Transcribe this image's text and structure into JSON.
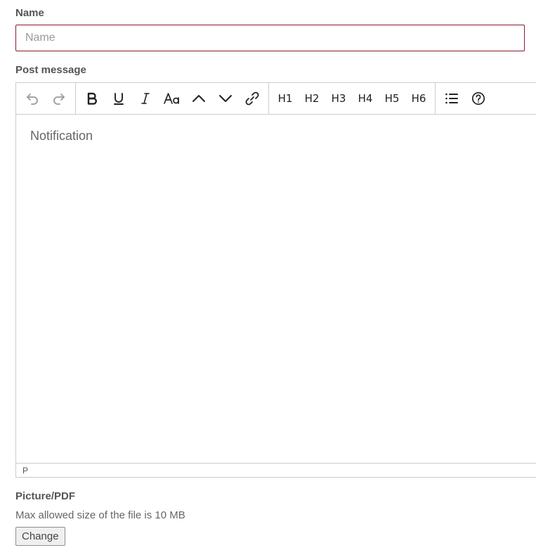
{
  "form": {
    "name_label": "Name",
    "name_placeholder": "Name",
    "name_value": "",
    "post_label": "Post message",
    "picture_label": "Picture/PDF",
    "file_hint": "Max allowed size of the file is 10 MB",
    "change_label": "Change"
  },
  "editor": {
    "placeholder": "Notification",
    "status_path": "P",
    "toolbar": {
      "history": [
        {
          "name": "undo-icon",
          "enabled": false
        },
        {
          "name": "redo-icon",
          "enabled": false
        }
      ],
      "formatting": [
        "bold-icon",
        "underline-icon",
        "italic-icon",
        "font-size-icon",
        "increase-indent-icon",
        "decrease-indent-icon",
        "link-icon"
      ],
      "headings": [
        "H1",
        "H2",
        "H3",
        "H4",
        "H5",
        "H6"
      ],
      "other": [
        "bullet-list-icon",
        "help-icon"
      ]
    }
  },
  "colors": {
    "input_border_active": "#8b1a2e",
    "border": "#cccccc",
    "label_text": "#555555",
    "placeholder_text": "#9a9a9a"
  }
}
